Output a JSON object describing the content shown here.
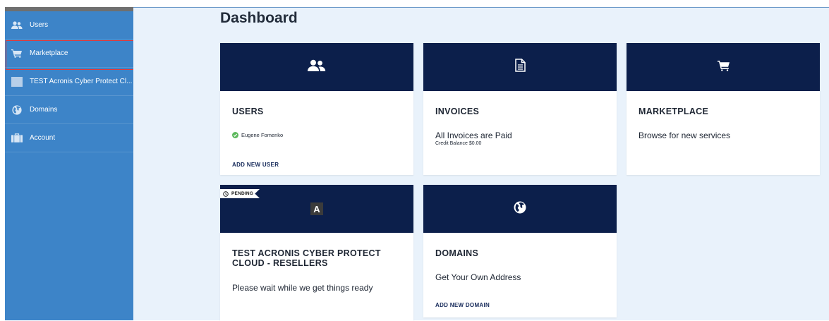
{
  "sidebar": {
    "items": [
      {
        "label": "Users",
        "icon": "users-icon"
      },
      {
        "label": "Marketplace",
        "icon": "cart-icon"
      },
      {
        "label": "TEST Acronis Cyber Protect Cl...",
        "icon": "square-icon"
      },
      {
        "label": "Domains",
        "icon": "globe-icon"
      },
      {
        "label": "Account",
        "icon": "briefcase-icon"
      }
    ]
  },
  "main": {
    "title": "Dashboard",
    "cards": {
      "users": {
        "title": "USERS",
        "status": "Eugene Fomenko",
        "link": "ADD NEW USER",
        "icon": "users-icon"
      },
      "invoices": {
        "title": "INVOICES",
        "line1": "All Invoices are Paid",
        "line2": "Credit Balance $0.00",
        "icon": "document-icon"
      },
      "marketplace": {
        "title": "MARKETPLACE",
        "line1": "Browse for new services",
        "icon": "cart-icon"
      },
      "acronis": {
        "badge": "PENDING",
        "title_line1": "TEST ACRONIS CYBER PROTECT",
        "title_line2": "CLOUD - RESELLERS",
        "line1": "Please wait while we get things ready",
        "logo_letter": "A"
      },
      "domains": {
        "title": "DOMAINS",
        "line1": "Get Your Own Address",
        "link": "ADD NEW DOMAIN",
        "icon": "globe-icon"
      }
    }
  },
  "colors": {
    "sidebar_bg": "#3d84c8",
    "card_header_bg": "#0c1f4b",
    "main_bg": "#e9f2fb",
    "highlight_border": "#e03b3b",
    "success_green": "#5cb85c"
  }
}
